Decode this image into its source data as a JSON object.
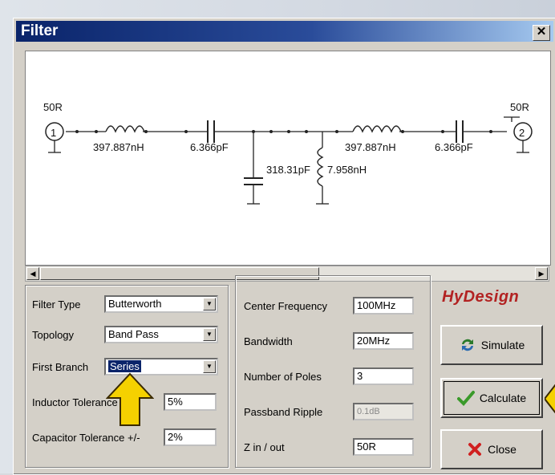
{
  "window": {
    "title": "Filter"
  },
  "schematic": {
    "port_in": {
      "number": "1",
      "impedance": "50R"
    },
    "port_out": {
      "number": "2",
      "impedance": "50R"
    },
    "series_inductor_1": "397.887nH",
    "series_capacitor_1": "6.366pF",
    "shunt_capacitor": "318.31pF",
    "shunt_inductor": "7.958nH",
    "series_inductor_2": "397.887nH",
    "series_capacitor_2": "6.366pF"
  },
  "left_panel": {
    "filter_type_label": "Filter Type",
    "filter_type_value": "Butterworth",
    "topology_label": "Topology",
    "topology_value": "Band Pass",
    "first_branch_label": "First Branch",
    "first_branch_value": "Series",
    "inductor_tol_label": "Inductor Tolerance +/-",
    "inductor_tol_value": "5%",
    "capacitor_tol_label": "Capacitor Tolerance +/-",
    "capacitor_tol_value": "2%"
  },
  "middle_panel": {
    "center_freq_label": "Center Frequency",
    "center_freq_value": "100MHz",
    "bandwidth_label": "Bandwidth",
    "bandwidth_value": "20MHz",
    "poles_label": "Number of Poles",
    "poles_value": "3",
    "ripple_label": "Passband Ripple",
    "ripple_value": "0.1dB",
    "z_label": "Z in / out",
    "z_value": "50R"
  },
  "brand": {
    "logo_text": "HyDesign"
  },
  "buttons": {
    "simulate": "Simulate",
    "calculate": "Calculate",
    "close": "Close"
  },
  "colors": {
    "title_bar": "#0a246a",
    "highlight": "#0a246a",
    "hint_arrow": "#f5d100",
    "calculate_icon": "#3a9a2a",
    "close_icon": "#d02020",
    "logo": "#b22222"
  }
}
